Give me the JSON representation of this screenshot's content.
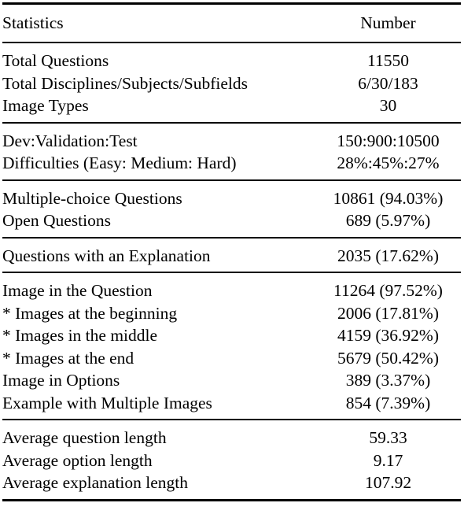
{
  "table": {
    "columns": [
      {
        "id": "statistics",
        "label": "Statistics",
        "align": "left"
      },
      {
        "id": "number",
        "label": "Number",
        "align": "center"
      }
    ],
    "groups": [
      {
        "id": "totals",
        "rows": [
          {
            "label": "Total Questions",
            "value": "11550",
            "indent": 0
          },
          {
            "label": "Total Disciplines/Subjects/Subfields",
            "value": "6/30/183",
            "indent": 0
          },
          {
            "label": "Image Types",
            "value": "30",
            "indent": 0
          }
        ]
      },
      {
        "id": "splits",
        "rows": [
          {
            "label": "Dev:Validation:Test",
            "value": "150:900:10500",
            "indent": 0
          },
          {
            "label": "Difficulties (Easy:  Medium:  Hard)",
            "value": "28%:45%:27%",
            "indent": 0
          }
        ]
      },
      {
        "id": "question-types",
        "rows": [
          {
            "label": "Multiple-choice Questions",
            "value": "10861 (94.03%)",
            "indent": 0
          },
          {
            "label": "Open Questions",
            "value": "689 (5.97%)",
            "indent": 0
          }
        ]
      },
      {
        "id": "explanations",
        "rows": [
          {
            "label": "Questions with an Explanation",
            "value": "2035 (17.62%)",
            "indent": 0
          }
        ]
      },
      {
        "id": "images",
        "rows": [
          {
            "label": "Image in the Question",
            "value": "11264 (97.52%)",
            "indent": 0
          },
          {
            "label": "* Images at the beginning",
            "value": "2006 (17.81%)",
            "indent": 1
          },
          {
            "label": "* Images in the middle",
            "value": "4159 (36.92%)",
            "indent": 1
          },
          {
            "label": "* Images at the end",
            "value": "5679 (50.42%)",
            "indent": 1
          },
          {
            "label": "Image in Options",
            "value": "389 (3.37%)",
            "indent": 0
          },
          {
            "label": "Example with Multiple Images",
            "value": "854 (7.39%)",
            "indent": 0
          }
        ]
      },
      {
        "id": "averages",
        "rows": [
          {
            "label": "Average question length",
            "value": "59.33",
            "indent": 0
          },
          {
            "label": "Average option length",
            "value": "9.17",
            "indent": 0
          },
          {
            "label": "Average explanation length",
            "value": "107.92",
            "indent": 0
          }
        ]
      }
    ]
  },
  "chart_data": {
    "type": "table",
    "title": "",
    "columns": [
      "Statistics",
      "Number"
    ],
    "rows": [
      [
        "Total Questions",
        "11550"
      ],
      [
        "Total Disciplines/Subjects/Subfields",
        "6/30/183"
      ],
      [
        "Image Types",
        "30"
      ],
      [
        "Dev:Validation:Test",
        "150:900:10500"
      ],
      [
        "Difficulties (Easy: Medium: Hard)",
        "28%:45%:27%"
      ],
      [
        "Multiple-choice Questions",
        "10861 (94.03%)"
      ],
      [
        "Open Questions",
        "689 (5.97%)"
      ],
      [
        "Questions with an Explanation",
        "2035 (17.62%)"
      ],
      [
        "Image in the Question",
        "11264 (97.52%)"
      ],
      [
        "* Images at the beginning",
        "2006 (17.81%)"
      ],
      [
        "* Images in the middle",
        "4159 (36.92%)"
      ],
      [
        "* Images at the end",
        "5679 (50.42%)"
      ],
      [
        "Image in Options",
        "389 (3.37%)"
      ],
      [
        "Example with Multiple Images",
        "854 (7.39%)"
      ],
      [
        "Average question length",
        "59.33"
      ],
      [
        "Average option length",
        "9.17"
      ],
      [
        "Average explanation length",
        "107.92"
      ]
    ]
  }
}
